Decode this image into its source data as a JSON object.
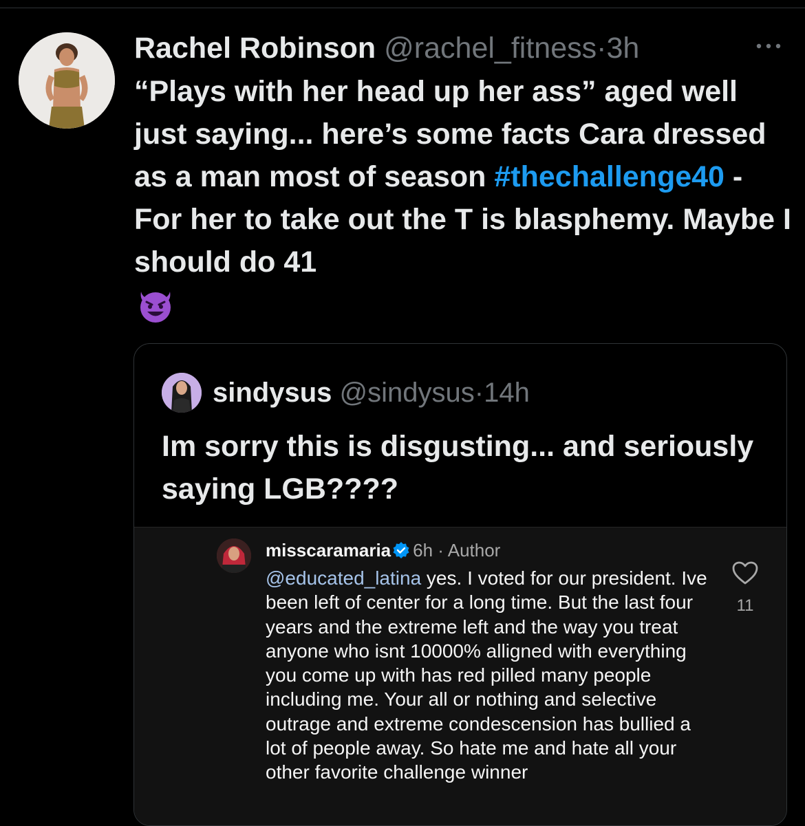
{
  "tweet": {
    "author_name": "Rachel Robinson",
    "handle": "@rachel_fitness",
    "separator": "·",
    "time": "3h",
    "text_before_hashtag": "“Plays with her head up her ass” aged well just saying... here’s some facts Cara dressed as a man most of season ",
    "hashtag": "#thechallenge40",
    "text_after_hashtag": " - For her to take out the T is blasphemy.  Maybe I should do 41",
    "emoji_icon": "smiling-devil-icon"
  },
  "quoted_tweet": {
    "author_name": "sindysus",
    "handle": "@sindysus",
    "separator": "·",
    "time": "14h",
    "text": "Im sorry this is disgusting... and seriously saying LGB????"
  },
  "instagram_comment": {
    "username": "misscaramaria",
    "meta": "6h · Author",
    "mention": "@educated_latina",
    "text": " yes. I voted for our president. Ive been left of center for a long time. But the last four years and the extreme left and the way you treat anyone who isnt 10000% alligned with everything you come up with has red pilled many people including me. Your all or nothing and selective outrage and extreme condescension has bullied a lot of people away.  So hate me and hate all your other favorite challenge winner",
    "like_count": "11"
  },
  "colors": {
    "background": "#000000",
    "text": "#e7e9ea",
    "secondary_text": "#71767b",
    "hashtag": "#1d9bf0",
    "instagram_panel": "#121212",
    "verified_badge": "#0095f6"
  }
}
